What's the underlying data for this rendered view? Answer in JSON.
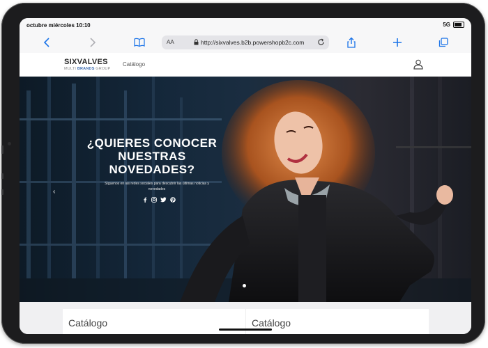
{
  "status_bar": {
    "time": "octubre miércoles 10:10",
    "network": "5G"
  },
  "browser": {
    "text_size": "AA",
    "url": "http://sixvalves.b2b.powershopb2c.com"
  },
  "site": {
    "logo_main": "SIXVALVES",
    "logo_sub_prefix": "MULTI",
    "logo_sub_brand": "BRANDS",
    "logo_sub_suffix": "GROUP",
    "nav_catalog": "Catálogo"
  },
  "hero": {
    "title_line1": "¿QUIERES CONOCER",
    "title_line2": "NUESTRAS",
    "title_line3": "NOVEDADES?",
    "subtitle": "Síguenos en las redes sociales para descubrir las últimas noticias y novedades",
    "prev_arrow": "‹"
  },
  "cards": [
    {
      "title": "Catálogo"
    },
    {
      "title": "Catálogo"
    }
  ]
}
